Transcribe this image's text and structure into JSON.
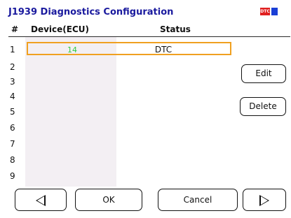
{
  "title": "J1939 Diagnostics Configuration",
  "status_icons": {
    "dtc_label": "DTC",
    "dtc_color": "#e02020",
    "square_color": "#1a3fd6"
  },
  "table": {
    "headers": {
      "index": "#",
      "device": "Device(ECU)",
      "status": "Status"
    },
    "rows": [
      {
        "num": "1",
        "device": "14",
        "status": "DTC"
      },
      {
        "num": "2",
        "device": "",
        "status": ""
      },
      {
        "num": "3",
        "device": "",
        "status": ""
      },
      {
        "num": "4",
        "device": "",
        "status": ""
      },
      {
        "num": "5",
        "device": "",
        "status": ""
      },
      {
        "num": "6",
        "device": "",
        "status": ""
      },
      {
        "num": "7",
        "device": "",
        "status": ""
      },
      {
        "num": "8",
        "device": "",
        "status": ""
      },
      {
        "num": "9",
        "device": "",
        "status": ""
      }
    ],
    "selected_row": 1,
    "selection_color": "#f0a020",
    "device_text_color": "#2ecc40"
  },
  "side_buttons": {
    "edit": "Edit",
    "delete": "Delete"
  },
  "bottom_buttons": {
    "prev_icon": "left-triangle-icon",
    "ok": "OK",
    "cancel": "Cancel",
    "next_icon": "right-triangle-icon"
  }
}
